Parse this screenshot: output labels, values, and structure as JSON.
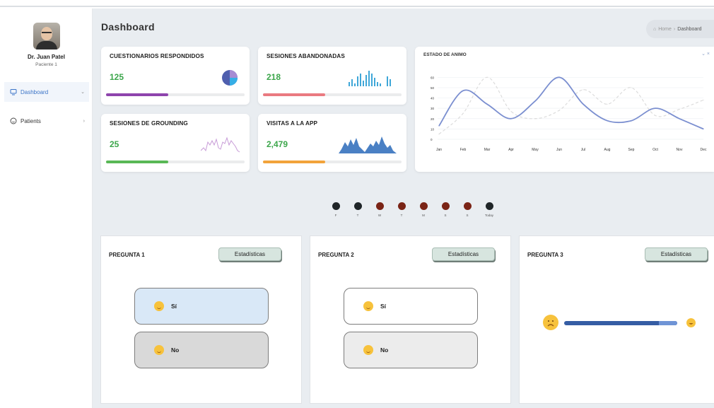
{
  "user": {
    "name": "Dr. Juan Patel",
    "role": "Paciente 1"
  },
  "nav": [
    {
      "label": "Dashboard",
      "icon": "monitor-icon"
    },
    {
      "label": "Patients",
      "icon": "smile-icon"
    }
  ],
  "page": {
    "title": "Dashboard",
    "breadcrumb": {
      "home": "Home",
      "separator": "›",
      "current": "Dashboard"
    }
  },
  "stats": [
    {
      "title": "CUESTIONARIOS RESPONDIDOS",
      "value": "125",
      "progress": 0.45,
      "color": "#8e44ad",
      "spark": "pie-icon"
    },
    {
      "title": "SESIONES ABANDONADAS",
      "value": "218",
      "progress": 0.45,
      "color": "#ea7a80",
      "spark": "bars-icon"
    },
    {
      "title": "SESIONES DE GROUNDING",
      "value": "25",
      "progress": 0.45,
      "color": "#59b856",
      "spark": "line-icon"
    },
    {
      "title": "VISITAS A LA APP",
      "value": "2,479",
      "progress": 0.45,
      "color": "#f2a33a",
      "spark": "area-icon"
    }
  ],
  "mood_card": {
    "title": "ESTADO DE ANIMO",
    "controls": "⌄ ×"
  },
  "chart_data": {
    "type": "line",
    "title": "ESTADO DE ANIMO",
    "categories": [
      "Jan",
      "Feb",
      "Mar",
      "Apr",
      "May",
      "Jun",
      "Jul",
      "Aug",
      "Sep",
      "Oct",
      "Nov",
      "Dec"
    ],
    "yticks": [
      0,
      10,
      20,
      30,
      40,
      50,
      60
    ],
    "ylim": [
      0,
      65
    ],
    "grid": true,
    "series": [
      {
        "values": [
          13,
          47,
          34,
          20,
          37,
          60,
          34,
          18,
          18,
          30,
          20,
          10
        ],
        "color": "#7b8fd0",
        "style": "solid"
      },
      {
        "values": [
          5,
          25,
          60,
          27,
          20,
          28,
          48,
          34,
          50,
          23,
          29,
          38
        ],
        "color": "#dcdcdc",
        "style": "dashed"
      }
    ]
  },
  "days": [
    {
      "label": "F",
      "color": "#1f2528"
    },
    {
      "label": "T",
      "color": "#1f2528"
    },
    {
      "label": "W",
      "color": "#7a2416"
    },
    {
      "label": "T",
      "color": "#7a2416"
    },
    {
      "label": "M",
      "color": "#7a2416"
    },
    {
      "label": "S",
      "color": "#7a2416"
    },
    {
      "label": "S",
      "color": "#7a2416"
    },
    {
      "label": "Today",
      "color": "#1f2528"
    }
  ],
  "questions": [
    {
      "title": "PREGUNTA 1",
      "button": "Estadísticas",
      "yes": "Sí",
      "no": "No"
    },
    {
      "title": "PREGUNTA 2",
      "button": "Estadísticas",
      "yes": "Sí",
      "no": "No"
    },
    {
      "title": "PREGUNTA 3",
      "button": "Estadísticas",
      "slider_value": 0.85
    }
  ]
}
